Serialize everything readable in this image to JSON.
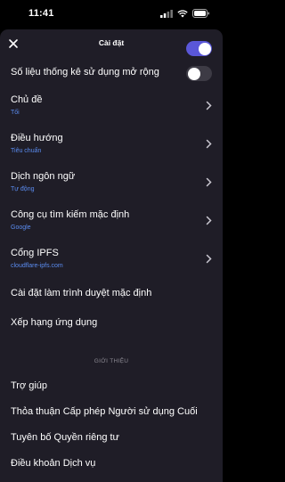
{
  "status_bar": {
    "time": "11:41"
  },
  "sheet": {
    "title": "Cài đặt"
  },
  "partial_row": {
    "label": "..."
  },
  "usage_stats": {
    "label": "Số liệu thống kê sử dụng mở rộng",
    "enabled": false
  },
  "rows": [
    {
      "title": "Chủ đề",
      "subtitle": "Tối"
    },
    {
      "title": "Điều hướng",
      "subtitle": "Tiêu chuẩn"
    },
    {
      "title": "Dịch ngôn ngữ",
      "subtitle": "Tự động"
    },
    {
      "title": "Công cụ tìm kiếm mặc định",
      "subtitle": "Google"
    },
    {
      "title": "Cổng IPFS",
      "subtitle": "cloudflare-ipfs.com"
    }
  ],
  "actions": [
    {
      "title": "Cài đặt làm trình duyệt mặc định"
    },
    {
      "title": "Xếp hạng ứng dụng"
    }
  ],
  "about_section": {
    "label": "GIỚI THIỆU",
    "items": [
      {
        "title": "Trợ giúp"
      },
      {
        "title": "Thỏa thuận Cấp phép Người sử dụng Cuối"
      },
      {
        "title": "Tuyên bố Quyền riêng tư"
      },
      {
        "title": "Điều khoản Dịch vụ"
      }
    ]
  },
  "colors": {
    "accent": "#5a57d8",
    "subtitle": "#5b8cf0",
    "sheet_bg": "#1f1d27"
  }
}
